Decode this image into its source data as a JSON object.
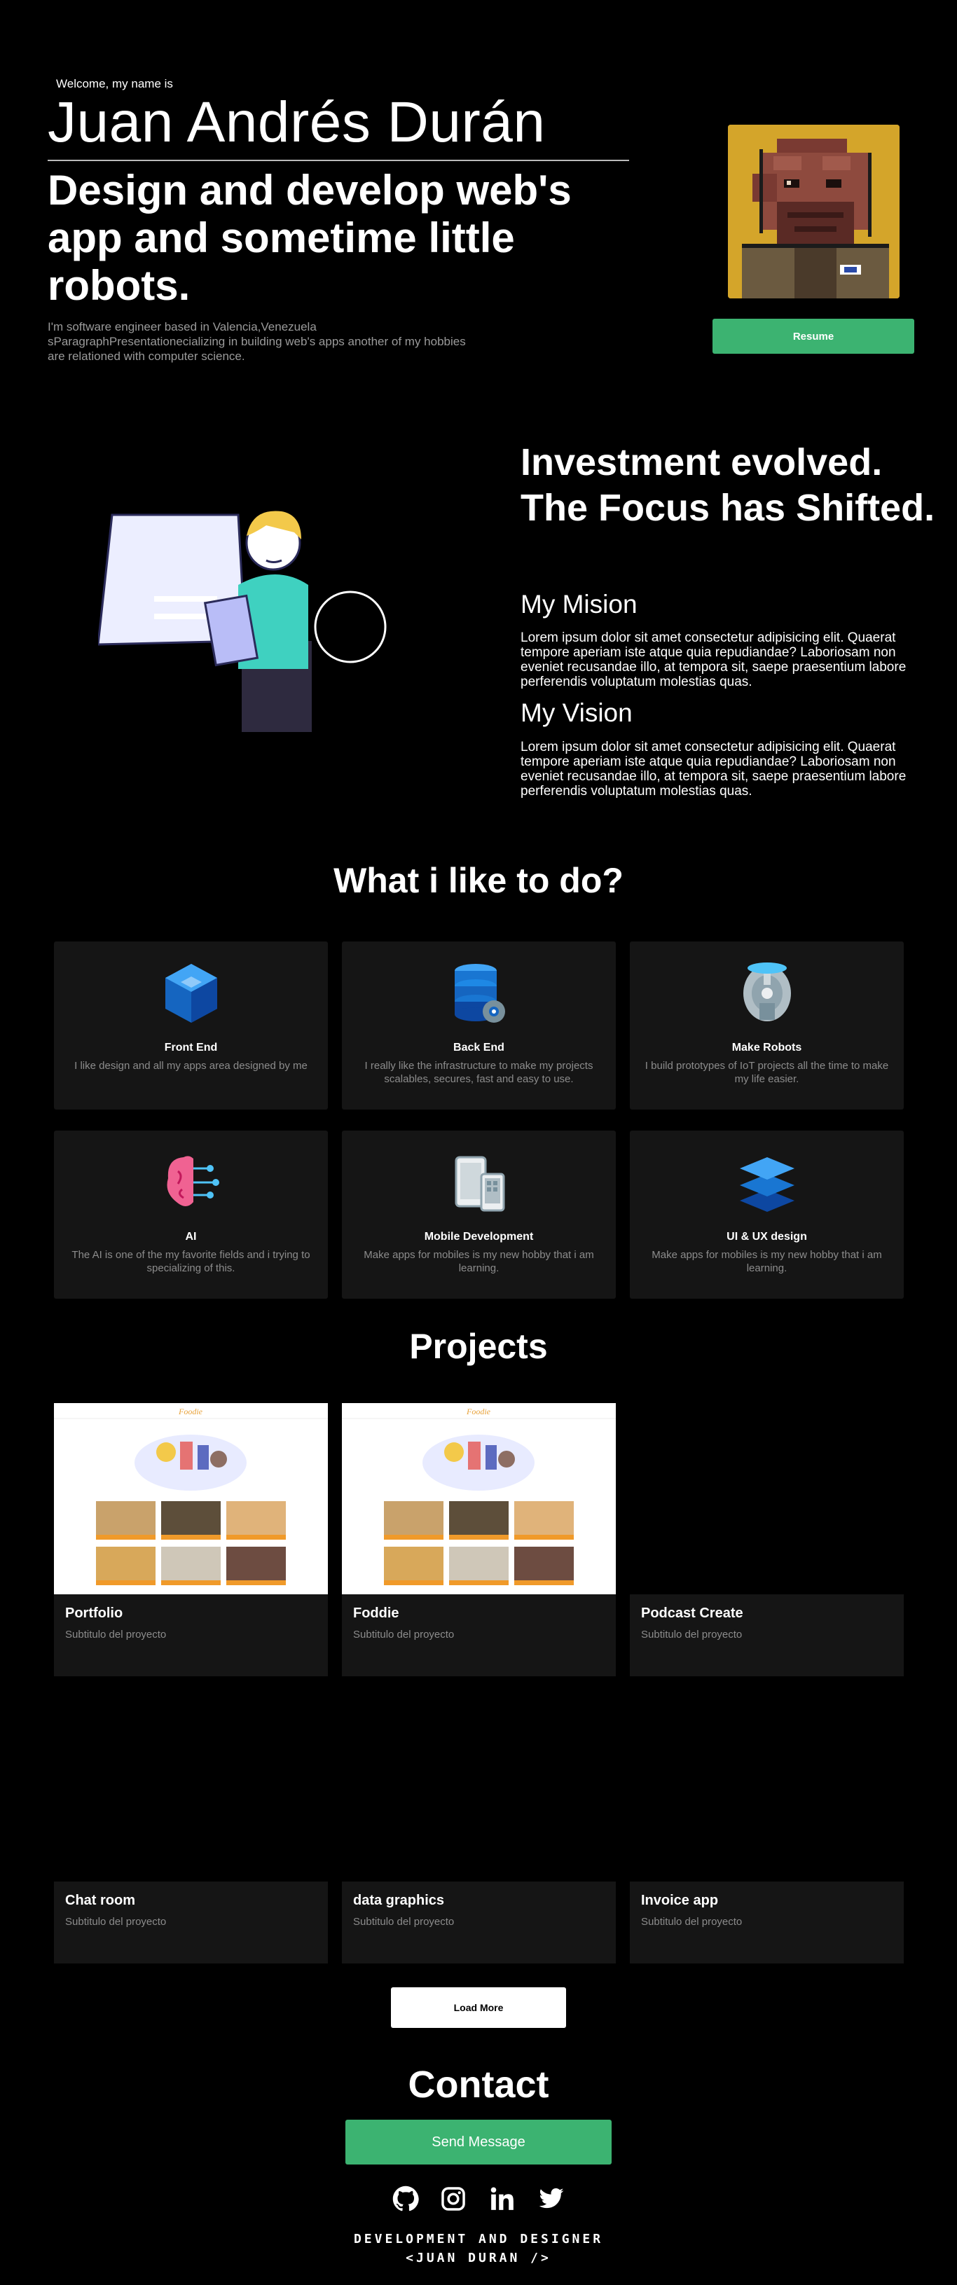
{
  "hero": {
    "welcome": "Welcome, my name is",
    "name": "Juan Andrés Durán",
    "tagline": "Design and develop web's app and sometime little robots.",
    "intro": "I'm software engineer based in Valencia,Venezuela sParagraphPresentationecializing in building web's apps another of my hobbies are relationed with computer science.",
    "resume_label": "Resume"
  },
  "mission": {
    "title": "Investment evolved. The Focus has Shifted.",
    "mision_heading": "My Mision",
    "mision_text": "Lorem ipsum dolor sit amet consectetur adipisicing elit. Quaerat tempore aperiam iste atque quia repudiandae? Laboriosam non eveniet recusandae illo, at tempora sit, saepe praesentium labore perferendis voluptatum molestias quas.",
    "vision_heading": "My Vision",
    "vision_text": "Lorem ipsum dolor sit amet consectetur adipisicing elit. Quaerat tempore aperiam iste atque quia repudiandae? Laboriosam non eveniet recusandae illo, at tempora sit, saepe praesentium labore perferendis voluptatum molestias quas."
  },
  "likes": {
    "title": "What i like to do?",
    "cards": [
      {
        "title": "Front End",
        "desc": "I like design and all my apps area designed by me",
        "icon": "cube-icon"
      },
      {
        "title": "Back End",
        "desc": "I really like the infrastructure to make my projects scalables, secures, fast and easy to use.",
        "icon": "database-gear-icon"
      },
      {
        "title": "Make Robots",
        "desc": "I build prototypes of IoT projects all the time to make my life easier.",
        "icon": "spaceship-icon"
      },
      {
        "title": "AI",
        "desc": "The AI is one of the my favorite fields and i trying to specializing of this.",
        "icon": "brain-circuit-icon"
      },
      {
        "title": "Mobile Development",
        "desc": "Make apps for mobiles is my new hobby that i am learning.",
        "icon": "devices-icon"
      },
      {
        "title": "UI & UX design",
        "desc": "Make apps for mobiles is my new hobby that i am learning.",
        "icon": "layers-icon"
      }
    ]
  },
  "projects": {
    "title": "Projects",
    "items": [
      {
        "title": "Portfolio",
        "subtitle": "Subtitulo del proyecto",
        "shot_brand": "Foodie"
      },
      {
        "title": "Foddie",
        "subtitle": "Subtitulo del proyecto",
        "shot_brand": "Foodie"
      },
      {
        "title": "Podcast Create",
        "subtitle": "Subtitulo del proyecto"
      },
      {
        "title": "Chat room",
        "subtitle": "Subtitulo del proyecto"
      },
      {
        "title": "data graphics",
        "subtitle": "Subtitulo del proyecto"
      },
      {
        "title": "Invoice app",
        "subtitle": "Subtitulo del proyecto"
      }
    ],
    "load_more_label": "Load More"
  },
  "contact": {
    "title": "Contact",
    "send_label": "Send Message",
    "socials": [
      "github-icon",
      "instagram-icon",
      "linkedin-icon",
      "twitter-icon"
    ]
  },
  "footer": {
    "line1": "DEVELOPMENT AND DESIGNER",
    "line2": "<JUAN DURAN />"
  },
  "colors": {
    "background": "#000000",
    "accent_green": "#3cb371",
    "card_bg": "#151515",
    "muted_text": "#8c8c8c"
  }
}
